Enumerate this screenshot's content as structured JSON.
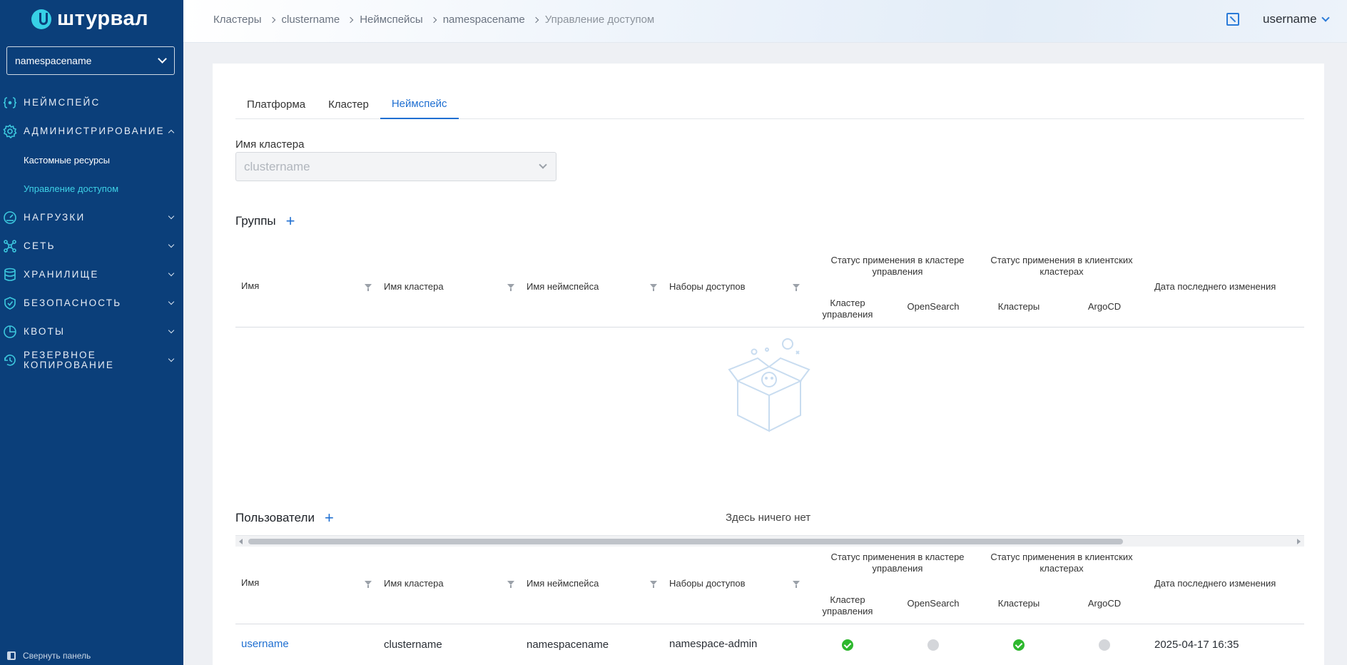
{
  "brand": {
    "name": "штурвал"
  },
  "sidebar": {
    "namespace_select": "namespacename",
    "items": [
      {
        "label": "Неймспейс"
      },
      {
        "label": "Администрирование"
      },
      {
        "label": "Нагрузки"
      },
      {
        "label": "Сеть"
      },
      {
        "label": "Хранилище"
      },
      {
        "label": "Безопасность"
      },
      {
        "label": "Квоты"
      },
      {
        "label": "Резервное копирование"
      }
    ],
    "sub_items": [
      "Кастомные ресурсы",
      "Управление доступом"
    ],
    "collapse_label": "Свернуть панель"
  },
  "header": {
    "breadcrumb": [
      "Кластеры",
      "clustername",
      "Неймспейсы",
      "namespacename",
      "Управление доступом"
    ],
    "user": "username"
  },
  "tabs": [
    "Платформа",
    "Кластер",
    "Неймспейс"
  ],
  "cluster_field": {
    "label": "Имя кластера",
    "value": "clustername"
  },
  "groups": {
    "title": "Группы",
    "columns": {
      "name": "Имя",
      "cluster": "Имя кластера",
      "namespace": "Имя неймспейса",
      "access_sets": "Наборы доступов",
      "mgmt_status": "Статус применения в кластере управления",
      "mgmt_cluster": "Кластер управления",
      "opensearch": "OpenSearch",
      "client_status": "Статус применения в клиентских кластерах",
      "clusters": "Кластеры",
      "argocd": "ArgoCD",
      "modified": "Дата последнего изменения"
    },
    "empty_text": "Здесь ничего нет"
  },
  "users": {
    "title": "Пользователи",
    "columns": {
      "name": "Имя",
      "cluster": "Имя кластера",
      "namespace": "Имя неймспейса",
      "access_sets": "Наборы доступов",
      "mgmt_status": "Статус применения в кластере управления",
      "mgmt_cluster": "Кластер управления",
      "opensearch": "OpenSearch",
      "client_status": "Статус применения в клиентских кластерах",
      "clusters": "Кластеры",
      "argocd": "ArgoCD",
      "modified": "Дата последнего изменения"
    },
    "rows": [
      {
        "name": "username",
        "cluster": "clustername",
        "namespace": "namespacename",
        "access_set": "namespace-admin",
        "mgmt_cluster_status": "applied",
        "opensearch_status": "not-applied",
        "clusters_status": "applied",
        "argocd_status": "not-applied",
        "modified": "2025-04-17 16:35"
      }
    ]
  },
  "colors": {
    "sidebar": "#0b3f7a",
    "accent": "#1f6fd1",
    "cyan": "#3ed1e6",
    "ok": "#2eb82e",
    "off": "#d4d6da"
  }
}
